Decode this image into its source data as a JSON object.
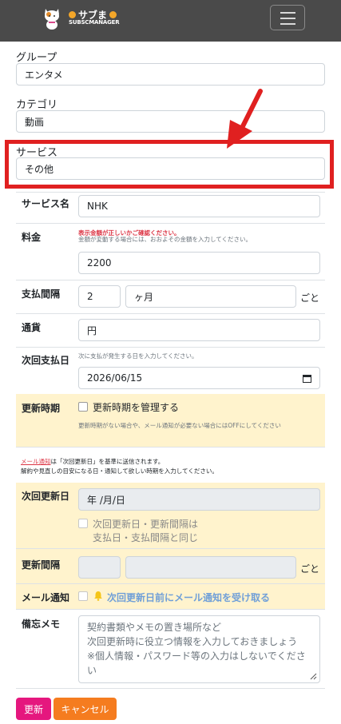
{
  "header": {
    "logo_title": "サブま",
    "logo_subtitle": "SUBSCMANAGER"
  },
  "group": {
    "label": "グループ",
    "value": "エンタメ"
  },
  "category": {
    "label": "カテゴリ",
    "value": "動画"
  },
  "service": {
    "label": "サービス",
    "value": "その他"
  },
  "service_name": {
    "label": "サービス名",
    "value": "NHK"
  },
  "price": {
    "label": "料金",
    "warning": "表示金額が正しいかご確認ください。",
    "hint": "金額が変動する場合には、おおよその金額を入力してください。",
    "value": "2200"
  },
  "interval": {
    "label": "支払間隔",
    "value": "2",
    "unit": "ヶ月",
    "suffix": "ごと"
  },
  "currency": {
    "label": "通貨",
    "value": "円"
  },
  "next_payment": {
    "label": "次回支払日",
    "hint": "次に支払が発生する日を入力してください。",
    "value": "2026/06/15"
  },
  "renewal": {
    "label": "更新時期",
    "checkbox_label": "更新時期を管理する",
    "hint": "更新時期がない場合や、メール通知が必要ない場合にはOFFにしてください",
    "mail_link": "メール通知",
    "mail_note_rest": "は「次回更新日」を基準に送信されます。",
    "mail_note_line2": "解約や見直しの目安になる日・通知して欲しい時期を入力してください。"
  },
  "next_renewal": {
    "label": "次回更新日",
    "placeholder": "年 /月/日",
    "same_label_line1": "次回更新日・更新間隔は",
    "same_label_line2": "支払日・支払間隔と同じ"
  },
  "renewal_interval": {
    "label": "更新間隔",
    "suffix": "ごと"
  },
  "mail_notify": {
    "label": "メール通知",
    "checkbox_label": "次回更新日前にメール通知を受け取る"
  },
  "memo": {
    "label": "備忘メモ",
    "placeholder_line1": "契約書類やメモの置き場所など",
    "placeholder_line2": "次回更新時に役立つ情報を入力しておきましょう",
    "placeholder_line3": "※個人情報・パスワード等の入力はしないでくださ",
    "placeholder_line4": "い"
  },
  "buttons": {
    "update": "更新",
    "cancel": "キャンセル"
  },
  "colors": {
    "update": "#e5177e",
    "cancel": "#f57c1f",
    "annotation": "#e02020"
  }
}
